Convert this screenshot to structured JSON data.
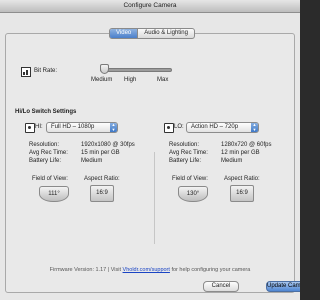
{
  "window": {
    "title": "Configure Camera"
  },
  "tabs": [
    {
      "label": "Video",
      "active": true
    },
    {
      "label": "Audio & Lighting",
      "active": false
    }
  ],
  "bitrate": {
    "label": "Bit Rate:",
    "options": [
      "Medium",
      "High",
      "Max"
    ],
    "selected": "Medium"
  },
  "switch_settings": {
    "heading": "Hi/Lo Switch Settings",
    "hi": {
      "label": "HI:",
      "mode": "Full HD – 1080p",
      "stats": [
        {
          "key": "Resolution:",
          "value": "1920x1080 @ 30fps"
        },
        {
          "key": "Avg Rec Time:",
          "value": "15 min per GB"
        },
        {
          "key": "Battery Life:",
          "value": "Medium"
        }
      ],
      "fov_label": "Field of View:",
      "fov_value": "111°",
      "aspect_label": "Aspect Ratio:",
      "aspect_value": "16:9"
    },
    "lo": {
      "label": "LO:",
      "mode": "Action HD – 720p",
      "stats": [
        {
          "key": "Resolution:",
          "value": "1280x720 @ 60fps"
        },
        {
          "key": "Avg Rec Time:",
          "value": "12 min per GB"
        },
        {
          "key": "Battery Life:",
          "value": "Medium"
        }
      ],
      "fov_label": "Field of View:",
      "fov_value": "130°",
      "aspect_label": "Aspect Ratio:",
      "aspect_value": "16:9"
    }
  },
  "footer": {
    "firmware_prefix": "Firmware Version: 1.17  |  Visit ",
    "link": "Vholdr.com/support",
    "firmware_suffix": " for help configuring your camera"
  },
  "buttons": {
    "cancel": "Cancel",
    "update": "Update Camera"
  }
}
